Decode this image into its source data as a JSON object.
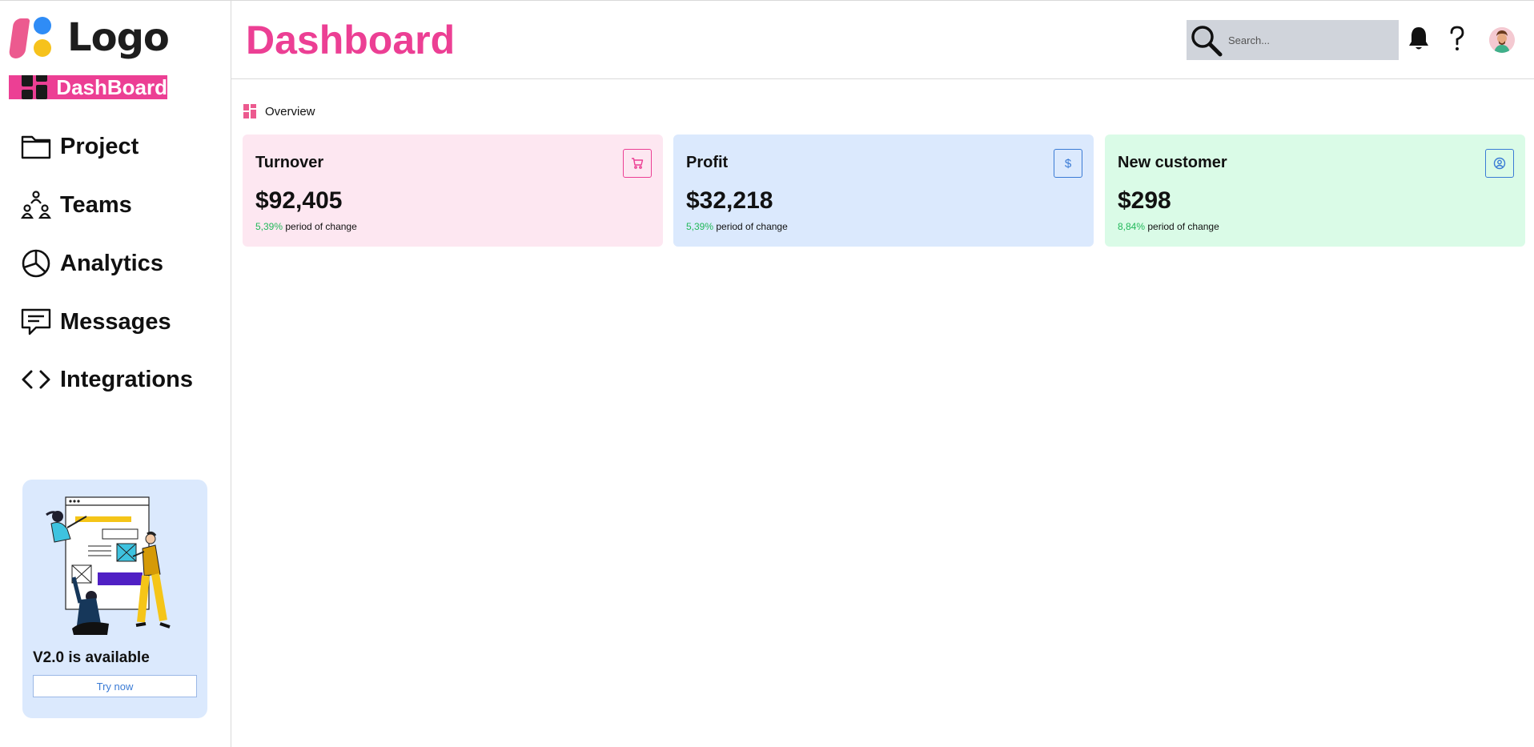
{
  "sidebar": {
    "logo_text": "Logo",
    "active_item": {
      "label": "DashBoard",
      "icon": "dashboard-grid-icon"
    },
    "items": [
      {
        "label": "Project",
        "icon": "folder-icon"
      },
      {
        "label": "Teams",
        "icon": "team-icon"
      },
      {
        "label": "Analytics",
        "icon": "pie-chart-icon"
      },
      {
        "label": "Messages",
        "icon": "message-icon"
      },
      {
        "label": "Integrations",
        "icon": "code-icon"
      }
    ],
    "promo": {
      "title": "V2.0 is available",
      "button_label": "Try now"
    }
  },
  "header": {
    "title": "Dashboard",
    "search": {
      "placeholder": "Search..."
    }
  },
  "overview": {
    "label": "Overview",
    "cards": [
      {
        "title": "Turnover",
        "value": "$92,405",
        "change_pct": "5,39%",
        "change_text": " period of change",
        "icon": "cart-icon",
        "icon_glyph": "",
        "bg": "#fde7f1",
        "accent": "#ec3f94"
      },
      {
        "title": "Profit",
        "value": "$32,218",
        "change_pct": "5,39%",
        "change_text": " period of change",
        "icon": "dollar-icon",
        "icon_glyph": "$",
        "bg": "#dbe9fd",
        "accent": "#3a7bd5"
      },
      {
        "title": "New customer",
        "value": "$298",
        "change_pct": "8,84%",
        "change_text": " period of change",
        "icon": "user-circle-icon",
        "icon_glyph": "",
        "bg": "#dafbe7",
        "accent": "#3a7bd5"
      }
    ]
  },
  "colors": {
    "brand_pink": "#ec3f94",
    "positive_green": "#22b85a"
  }
}
